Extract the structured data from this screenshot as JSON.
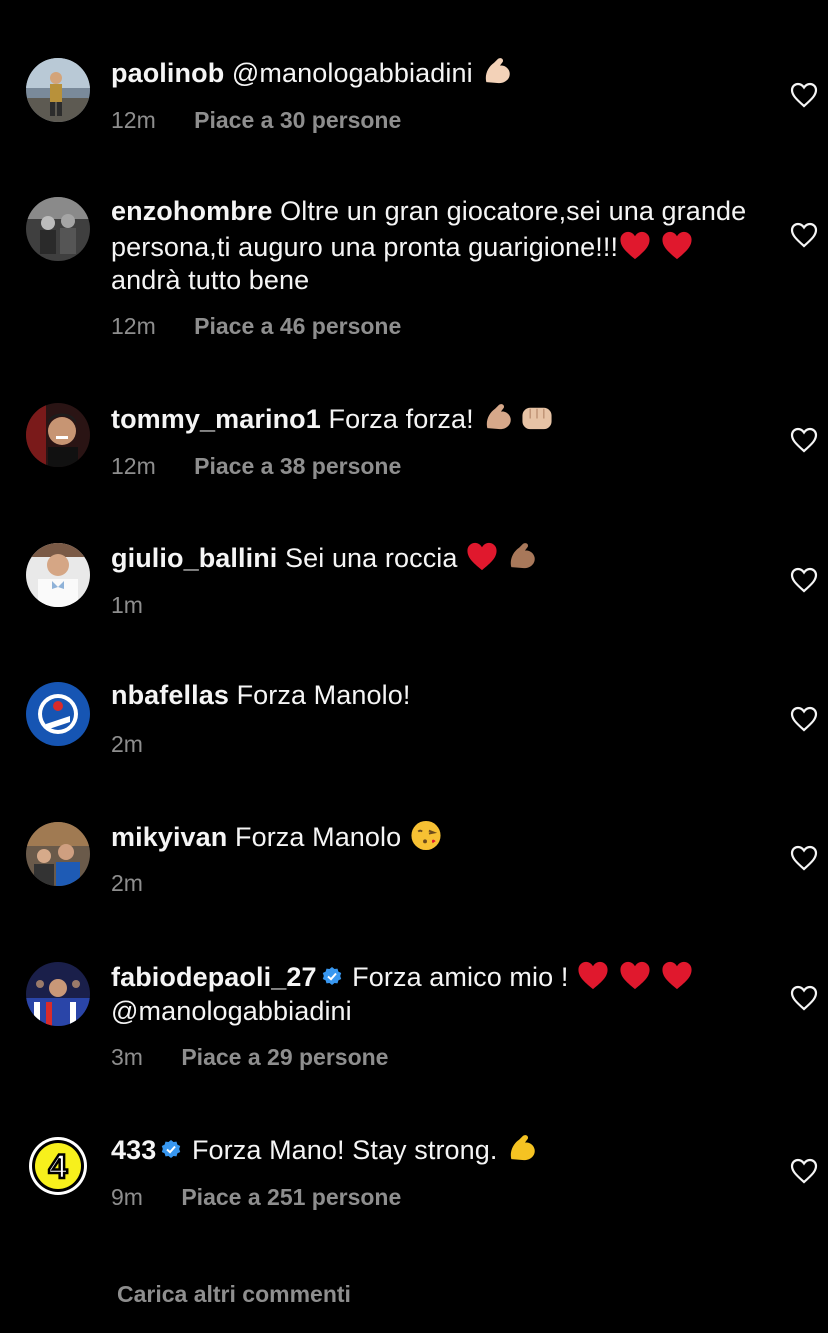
{
  "colors": {
    "background": "#000000",
    "text": "#f5f5f5",
    "secondary": "#8e8e8e",
    "verified": "#3897f0",
    "heart_emoji": "#e0182d"
  },
  "comments": [
    {
      "username": "paolinob",
      "verified": false,
      "text_parts": [
        "@manologabbiadini "
      ],
      "emojis": [
        "flexed-biceps-light"
      ],
      "time": "12m",
      "likes": "Piace a 30 persone"
    },
    {
      "username": "enzohombre",
      "verified": false,
      "text_parts": [
        "Oltre un gran giocatore,sei una grande persona,ti auguro una pronta guarigione!!!",
        "andrà tutto bene"
      ],
      "emojis": [
        "red-heart",
        "red-heart"
      ],
      "time": "12m",
      "likes": "Piace a 46 persone"
    },
    {
      "username": "tommy_marino1",
      "verified": false,
      "text_parts": [
        "Forza forza! "
      ],
      "emojis": [
        "flexed-biceps-medium",
        "oncoming-fist-light"
      ],
      "time": "12m",
      "likes": "Piace a 38 persone"
    },
    {
      "username": "giulio_ballini",
      "verified": false,
      "text_parts": [
        "Sei una roccia "
      ],
      "emojis": [
        "red-heart",
        "flexed-biceps-medium-dark"
      ],
      "time": "1m",
      "likes": ""
    },
    {
      "username": "nbafellas",
      "verified": false,
      "text_parts": [
        "Forza Manolo!"
      ],
      "emojis": [],
      "time": "2m",
      "likes": ""
    },
    {
      "username": "mikyivan",
      "verified": false,
      "text_parts": [
        "Forza Manolo "
      ],
      "emojis": [
        "face-blowing-kiss"
      ],
      "time": "2m",
      "likes": ""
    },
    {
      "username": "fabiodepaoli_27",
      "verified": true,
      "text_parts": [
        "Forza amico mio ! ",
        "@manologabbiadini"
      ],
      "emojis": [
        "red-heart",
        "red-heart",
        "red-heart"
      ],
      "time": "3m",
      "likes": "Piace a 29 persone"
    },
    {
      "username": "433",
      "verified": true,
      "text_parts": [
        "Forza Mano! Stay strong. "
      ],
      "emojis": [
        "flexed-biceps-yellow"
      ],
      "time": "9m",
      "likes": "Piace a 251 persone"
    }
  ],
  "avatars": {
    "433_logo_text": "4"
  },
  "load_more": "Carica altri commenti",
  "icons": {
    "like": "heart-outline-icon",
    "verified": "verified-badge-icon"
  }
}
